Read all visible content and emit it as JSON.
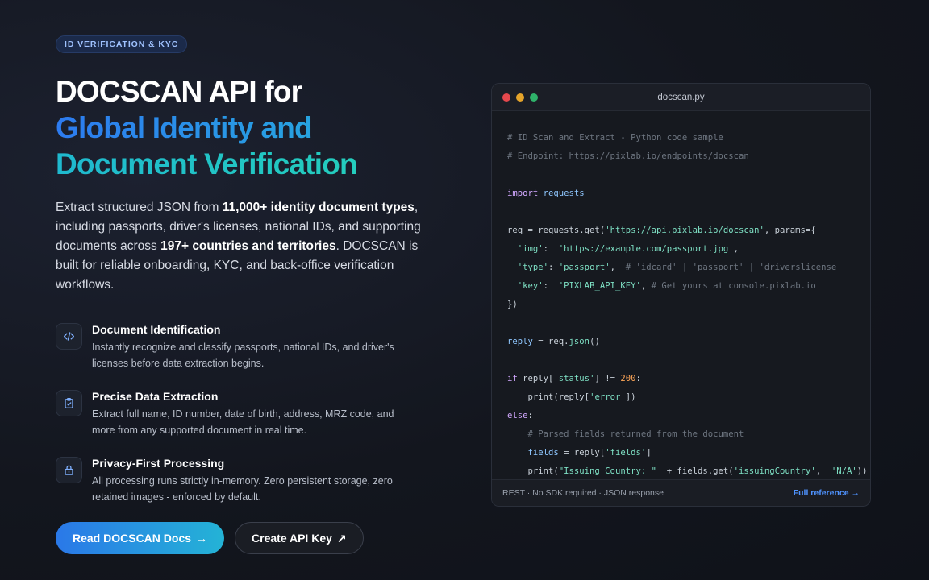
{
  "hero": {
    "badge": "ID VERIFICATION & KYC",
    "title_line1": "DOCSCAN API for",
    "title_line2": "Global Identity and",
    "title_line3": "Document Verification",
    "intro_p1": "Extract structured JSON from ",
    "intro_b1": "11,000+ identity document types",
    "intro_p2": ", including passports, driver's licenses, national IDs, and supporting documents across ",
    "intro_b2": "197+ countries and territories",
    "intro_p3": ". DOCSCAN is built for reliable onboarding, KYC, and back-office verification workflows."
  },
  "features": [
    {
      "icon": "code-icon",
      "title": "Document Identification",
      "desc": "Instantly recognize and classify passports, national IDs, and driver's licenses before data extraction begins."
    },
    {
      "icon": "clipboard-check-icon",
      "title": "Precise Data Extraction",
      "desc": "Extract full name, ID number, date of birth, address, MRZ code, and more from any supported document in real time."
    },
    {
      "icon": "lock-icon",
      "title": "Privacy-First Processing",
      "desc": "All processing runs strictly in-memory. Zero persistent storage, zero retained images - enforced by default."
    }
  ],
  "buttons": {
    "primary_label": "Read DOCSCAN Docs",
    "primary_arrow": "→",
    "secondary_label": "Create API Key",
    "secondary_arrow": "↗"
  },
  "code_window": {
    "filename": "docscan.py",
    "footer_meta": "REST · No SDK required · JSON response",
    "footer_link": "Full reference →",
    "lines": {
      "l1": "# ID Scan and Extract - Python code sample",
      "l2": "# Endpoint: https://pixlab.io/endpoints/docscan",
      "l3_kw": "import",
      "l3_mod": " requests",
      "l4_a": "req = requests.get(",
      "l4_str": "'https://api.pixlab.io/docscan'",
      "l4_b": ", params={",
      "l5_key": "  'img'",
      "l5_sep": ":  ",
      "l5_val": "'https://example.com/passport.jpg'",
      "l5_end": ",",
      "l6_key": "  'type'",
      "l6_sep": ": ",
      "l6_val": "'passport'",
      "l6_end": ",  ",
      "l6_com": "# 'idcard' | 'passport' | 'driverslicense'",
      "l7_key": "  'key'",
      "l7_sep": ":  ",
      "l7_val": "'PIXLAB_API_KEY'",
      "l7_end": ", ",
      "l7_com": "# Get yours at console.pixlab.io",
      "l8": "})",
      "l9_var": "reply",
      "l9_a": " = req.",
      "l9_fn": "json",
      "l9_b": "()",
      "l10_kw": "if",
      "l10_a": " reply[",
      "l10_str": "'status'",
      "l10_b": "] != ",
      "l10_num": "200",
      "l10_c": ":",
      "l11_a": "    print(reply[",
      "l11_str": "'error'",
      "l11_b": "])",
      "l12_kw": "else",
      "l12_b": ":",
      "l13": "    # Parsed fields returned from the document",
      "l14_var": "    fields",
      "l14_a": " = reply[",
      "l14_str": "'fields'",
      "l14_b": "]",
      "l15_a": "    print(",
      "l15_str1": "\"Issuing Country: \"",
      "l15_b": "  + fields.get(",
      "l15_str2": "'issuingCountry'",
      "l15_c": ",  ",
      "l15_str3": "'N/A'",
      "l15_d": "))"
    }
  }
}
